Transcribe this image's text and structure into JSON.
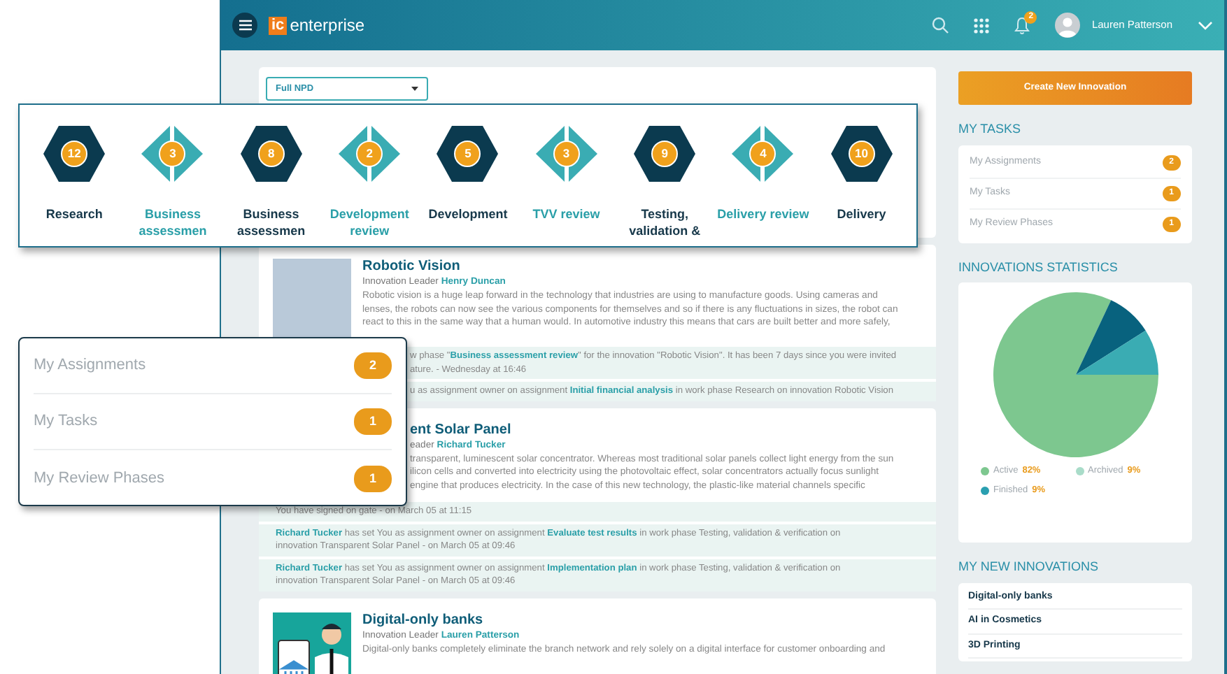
{
  "navbar": {
    "logo_mark": "ic",
    "logo_text": "enterprise",
    "notification_count": "2",
    "user_name": "Lauren Patterson"
  },
  "process_select": {
    "value": "Full NPD"
  },
  "phases": [
    {
      "kind": "gate",
      "count": "12",
      "label": "Research"
    },
    {
      "kind": "review",
      "count": "3",
      "label": "Business assessmen"
    },
    {
      "kind": "gate",
      "count": "8",
      "label": "Business assessmen"
    },
    {
      "kind": "review",
      "count": "2",
      "label": "Development review"
    },
    {
      "kind": "gate",
      "count": "5",
      "label": "Development"
    },
    {
      "kind": "review",
      "count": "3",
      "label": "TVV review"
    },
    {
      "kind": "gate",
      "count": "9",
      "label": "Testing, validation &"
    },
    {
      "kind": "review",
      "count": "4",
      "label": "Delivery review"
    },
    {
      "kind": "gate",
      "count": "10",
      "label": "Delivery"
    }
  ],
  "feed": [
    {
      "kind": "photo",
      "header_partly_hidden": false,
      "title": "Robotic Vision",
      "leader_label": "Innovation Leader",
      "leader": "Henry Duncan",
      "description_lines": [
        "Robotic vision is a huge leap forward in the technology that industries are using to manufacture goods. Using cameras and",
        "lenses, the robots can now see the various components for themselves and so if there is any fluctuations in sizes, the robot can",
        "react to this in the same way that a human would. In automotive industry this means that cars are built better and more safely,"
      ],
      "activities": [
        {
          "partly_hidden": true,
          "lines": [
            "w phase \"**Business assessment review**\" for the innovation \"Robotic Vision\". It has been 7 days since you were invited",
            "ature. - Wednesday at 16:46"
          ]
        },
        {
          "partly_hidden": true,
          "lines": [
            "u as assignment owner on assignment **Initial financial analysis** in work phase Research on innovation Robotic Vision"
          ]
        }
      ]
    },
    {
      "header_partly_hidden": true,
      "title": "ent Solar Panel",
      "leader_label": "eader",
      "leader": "Richard Tucker",
      "description_lines": [
        "transparent, luminescent solar concentrator. Whereas most traditional solar panels collect light energy from the sun",
        "ilicon cells and converted into electricity using the photovoltaic effect, solar concentrators actually focus sunlight",
        "engine that produces electricity. In the case of this new technology, the plastic-like material channels specific"
      ],
      "activities": [
        {
          "partly_hidden": false,
          "lines": [
            "You have signed on gate - on March 05 at 11:15"
          ]
        },
        {
          "partly_hidden": false,
          "lines": [
            "**Richard Tucker** has set You as assignment owner on assignment **Evaluate test results** in work phase Testing, validation & verification on",
            "innovation Transparent Solar Panel - on March 05 at 09:46"
          ]
        },
        {
          "partly_hidden": false,
          "lines": [
            "**Richard Tucker** has set You as assignment owner on assignment **Implementation plan** in work phase Testing, validation & verification on",
            "innovation Transparent Solar Panel - on March 05 at 09:46"
          ]
        }
      ]
    },
    {
      "kind": "illustration",
      "header_partly_hidden": false,
      "title": "Digital-only banks",
      "leader_label": "Innovation Leader",
      "leader": "Lauren Patterson",
      "description_lines": [
        "Digital-only banks completely eliminate the branch network and rely solely on a digital interface for customer onboarding and"
      ]
    }
  ],
  "create_button": "Create New Innovation",
  "my_tasks": {
    "heading": "MY TASKS",
    "items": [
      {
        "label": "My Assignments",
        "count": "2"
      },
      {
        "label": "My Tasks",
        "count": "1"
      },
      {
        "label": "My Review Phases",
        "count": "1"
      }
    ]
  },
  "statistics": {
    "heading": "INNOVATIONS STATISTICS",
    "chart_data": {
      "type": "pie",
      "categories": [
        "Active",
        "Archived",
        "Finished"
      ],
      "values": [
        82,
        9,
        9
      ],
      "colors": [
        "#7dc78f",
        "#08627e",
        "#3aacb3"
      ]
    },
    "legend": [
      {
        "value": "82%",
        "color": "#7dc78f"
      },
      {
        "value": "9%",
        "color": "#a9dcc9"
      },
      {
        "value": "9%",
        "color": "#2a9fb0"
      }
    ]
  },
  "new_innovations": {
    "heading": "MY NEW INNOVATIONS",
    "items": [
      "Digital-only banks",
      "AI in Cosmetics",
      "3D Printing"
    ]
  },
  "tasks_popup": {
    "items": [
      {
        "label": "My Assignments",
        "count": "2"
      },
      {
        "label": "My Tasks",
        "count": "1"
      },
      {
        "label": "My Review Phases",
        "count": "1"
      }
    ]
  }
}
